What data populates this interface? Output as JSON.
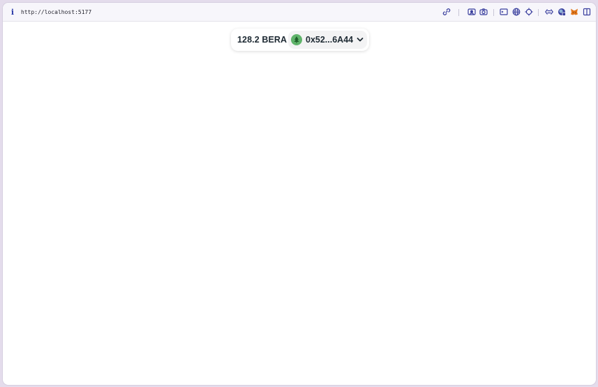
{
  "browser": {
    "info_icon": "info-icon",
    "url": "http://localhost:5177",
    "toolbar_icons": [
      "link-icon",
      "screenshot-icon",
      "camera-icon",
      "terminal-icon",
      "globe-icon",
      "crosshair-icon",
      "code-icon",
      "profile-icon",
      "metamask-fox-icon",
      "sidebar-icon"
    ]
  },
  "wallet": {
    "balance": "128.2 BERA",
    "address": "0x52...6A44",
    "avatar_icon": "tree-avatar-icon",
    "dropdown_icon": "chevron-down-icon",
    "avatar_color": "#5fb36a"
  },
  "colors": {
    "toolbar_icon": "#3a3f9e",
    "background": "#ffffff",
    "frame": "#e4dcec"
  }
}
